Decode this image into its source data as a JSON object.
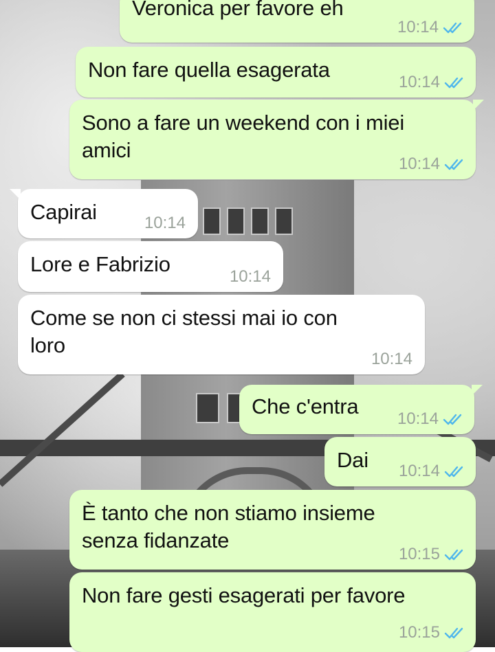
{
  "colors": {
    "outgoing_bubble": "#e2ffc7",
    "incoming_bubble": "#ffffff",
    "read_tick": "#4fb6ec",
    "timestamp": "#9aa29a"
  },
  "icons": {
    "read_receipt": "double-check-icon"
  },
  "messages": [
    {
      "direction": "out",
      "text": "Veronica per favore eh",
      "time": "10:14",
      "read": true
    },
    {
      "direction": "out",
      "text": "Non fare quella esagerata",
      "time": "10:14",
      "read": true
    },
    {
      "direction": "out",
      "text": "Sono a fare un weekend con i miei\namici",
      "time": "10:14",
      "read": true
    },
    {
      "direction": "in",
      "text": "Capirai",
      "time": "10:14"
    },
    {
      "direction": "in",
      "text": "Lore e Fabrizio",
      "time": "10:14"
    },
    {
      "direction": "in",
      "text": "Come se non ci stessi mai io con\nloro",
      "time": "10:14"
    },
    {
      "direction": "out",
      "text": "Che c'entra",
      "time": "10:14",
      "read": true
    },
    {
      "direction": "out",
      "text": "Dai",
      "time": "10:14",
      "read": true
    },
    {
      "direction": "out",
      "text": "È tanto che non stiamo insieme\nsenza fidanzate",
      "time": "10:15",
      "read": true
    },
    {
      "direction": "out",
      "text": "Non fare gesti esagerati per favore",
      "time": "10:15",
      "read": true
    }
  ]
}
